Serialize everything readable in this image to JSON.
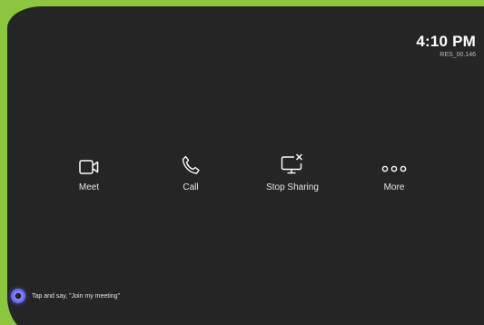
{
  "clock": {
    "time": "4:10 PM",
    "room_code": "RES_00.146"
  },
  "actions": [
    {
      "label": "Meet",
      "icon": "video-camera-icon"
    },
    {
      "label": "Call",
      "icon": "phone-icon"
    },
    {
      "label": "Stop Sharing",
      "icon": "stop-sharing-icon"
    },
    {
      "label": "More",
      "icon": "more-dots-icon"
    }
  ],
  "assistant": {
    "prompt": "Tap and say, \"Join my meeting\"",
    "icon": "cortana-ring-icon"
  },
  "colors": {
    "accent_green": "#8cc63f",
    "panel_background": "#252525",
    "text": "#ffffff"
  }
}
